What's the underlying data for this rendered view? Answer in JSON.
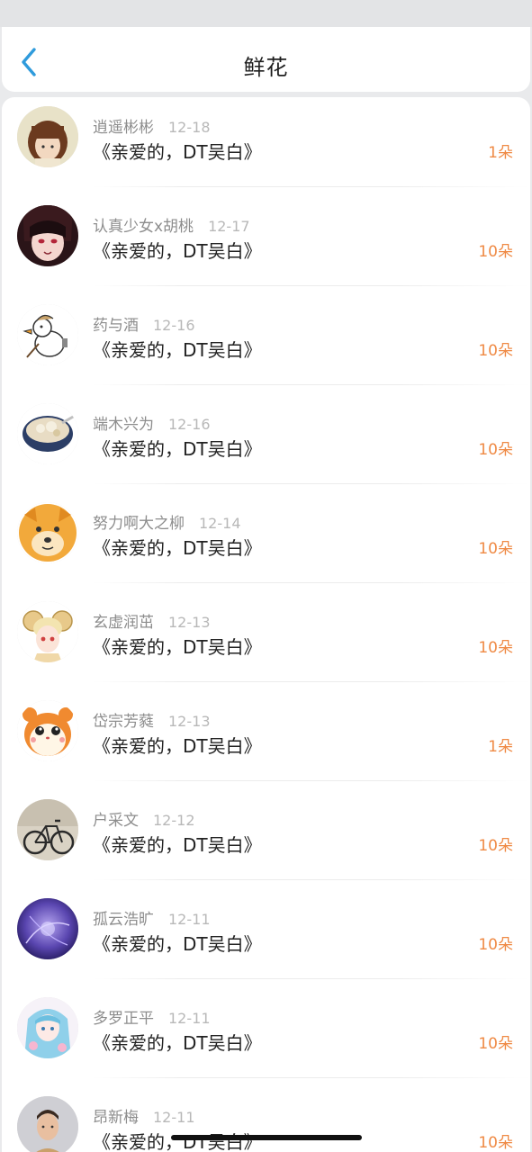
{
  "header": {
    "title": "鲜花",
    "back_icon": "chevron-left-icon",
    "accent_color": "#2f9bdc"
  },
  "colors": {
    "count_color": "#ef8a45",
    "name_color": "#8d8d8d",
    "date_color": "#b8b8b8"
  },
  "gifts": [
    {
      "name": "逍遥彬彬",
      "date": "12-18",
      "title": "《亲爱的，DT吴白》",
      "count": "1朵",
      "avatar": "bob-haircut-avatar"
    },
    {
      "name": "认真少女x胡桃",
      "date": "12-17",
      "title": "《亲爱的，DT吴白》",
      "count": "10朵",
      "avatar": "anime-girl-avatar"
    },
    {
      "name": "药与酒",
      "date": "12-16",
      "title": "《亲爱的，DT吴白》",
      "count": "10朵",
      "avatar": "cartoon-duck-avatar"
    },
    {
      "name": "端木兴为",
      "date": "12-16",
      "title": "《亲爱的，DT吴白》",
      "count": "10朵",
      "avatar": "soup-bowl-avatar"
    },
    {
      "name": "努力啊大之柳",
      "date": "12-14",
      "title": "《亲爱的，DT吴白》",
      "count": "10朵",
      "avatar": "shiba-dog-avatar"
    },
    {
      "name": "玄虚润茁",
      "date": "12-13",
      "title": "《亲爱的，DT吴白》",
      "count": "10朵",
      "avatar": "anime-ram-girl-avatar"
    },
    {
      "name": "岱宗芳蕤",
      "date": "12-13",
      "title": "《亲爱的，DT吴白》",
      "count": "1朵",
      "avatar": "hamster-avatar"
    },
    {
      "name": "户采文",
      "date": "12-12",
      "title": "《亲爱的，DT吴白》",
      "count": "10朵",
      "avatar": "bicycle-avatar"
    },
    {
      "name": "孤云浩旷",
      "date": "12-11",
      "title": "《亲爱的，DT吴白》",
      "count": "10朵",
      "avatar": "purple-abstract-avatar"
    },
    {
      "name": "多罗正平",
      "date": "12-11",
      "title": "《亲爱的，DT吴白》",
      "count": "10朵",
      "avatar": "anime-blue-hair-avatar"
    },
    {
      "name": "昂新梅",
      "date": "12-11",
      "title": "《亲爱的，DT吴白》",
      "count": "10朵",
      "avatar": "man-portrait-avatar"
    }
  ]
}
